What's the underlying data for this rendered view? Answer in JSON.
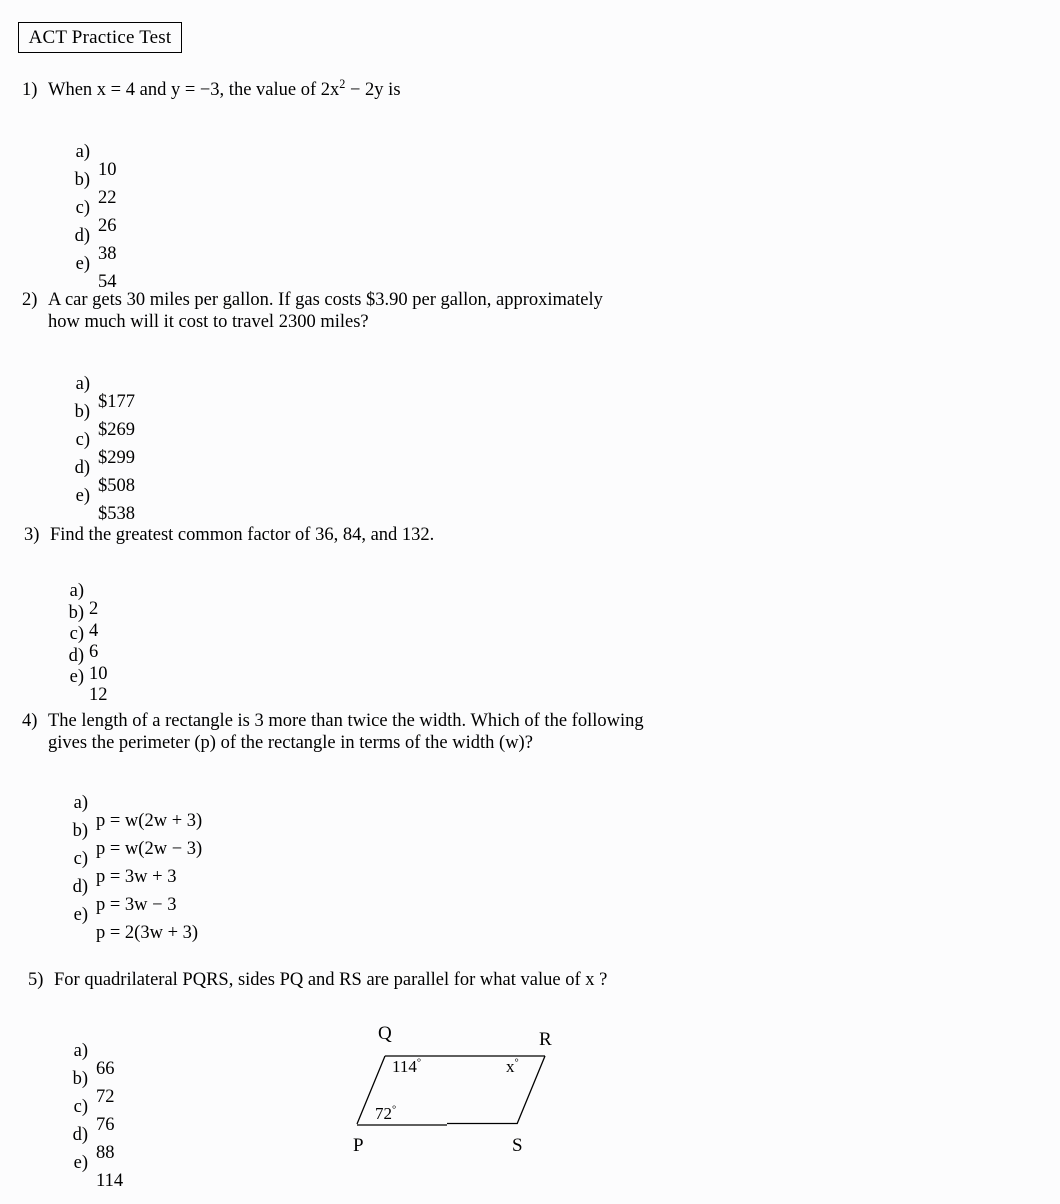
{
  "header": {
    "title": "ACT Practice Test"
  },
  "questions": [
    {
      "number": "1)",
      "stem_pre": "When x = 4 and y = −3, the value of  2x",
      "stem_exp": "2",
      "stem_post": " − 2y  is",
      "options": [
        {
          "letter": "a)",
          "text": "10"
        },
        {
          "letter": "b)",
          "text": "22"
        },
        {
          "letter": "c)",
          "text": "26"
        },
        {
          "letter": "d)",
          "text": "38"
        },
        {
          "letter": "e)",
          "text": "54"
        }
      ]
    },
    {
      "number": "2)",
      "line1": "A car gets 30 miles per gallon.  If gas costs $3.90 per gallon, approximately",
      "line2": "how much will it cost to travel 2300 miles?",
      "options": [
        {
          "letter": "a)",
          "text": "$177"
        },
        {
          "letter": "b)",
          "text": "$269"
        },
        {
          "letter": "c)",
          "text": "$299"
        },
        {
          "letter": "d)",
          "text": "$508"
        },
        {
          "letter": "e)",
          "text": "$538"
        }
      ]
    },
    {
      "number": "3)",
      "line1": "Find the greatest common factor of   36, 84, and 132.",
      "options": [
        {
          "letter": "a)",
          "text": "2"
        },
        {
          "letter": "b)",
          "text": "4"
        },
        {
          "letter": "c)",
          "text": "6"
        },
        {
          "letter": "d)",
          "text": "10"
        },
        {
          "letter": "e)",
          "text": "12"
        }
      ]
    },
    {
      "number": "4)",
      "line1": "The length of a rectangle is 3 more than twice the width.  Which of the following",
      "line2": "gives the perimeter (p) of the rectangle in terms of the width (w)?",
      "options": [
        {
          "letter": "a)",
          "text": "p = w(2w + 3)"
        },
        {
          "letter": "b)",
          "text": "p = w(2w − 3)"
        },
        {
          "letter": "c)",
          "text": "p = 3w + 3"
        },
        {
          "letter": "d)",
          "text": "p = 3w − 3"
        },
        {
          "letter": "e)",
          "text": "p = 2(3w + 3)"
        }
      ]
    },
    {
      "number": "5)",
      "line1": "For quadrilateral  PQRS, sides PQ and RS are parallel for what value of x  ?",
      "options": [
        {
          "letter": "a)",
          "text": "66"
        },
        {
          "letter": "b)",
          "text": "72"
        },
        {
          "letter": "c)",
          "text": "76"
        },
        {
          "letter": "d)",
          "text": "88"
        },
        {
          "letter": "e)",
          "text": "114"
        }
      ]
    }
  ],
  "figure": {
    "vertices": {
      "P": "P",
      "Q": "Q",
      "R": "R",
      "S": "S"
    },
    "angles": {
      "at_Q": "114",
      "at_R": "x",
      "at_P": "72",
      "degree_symbol": "°"
    },
    "stroke_color": "#000000"
  }
}
